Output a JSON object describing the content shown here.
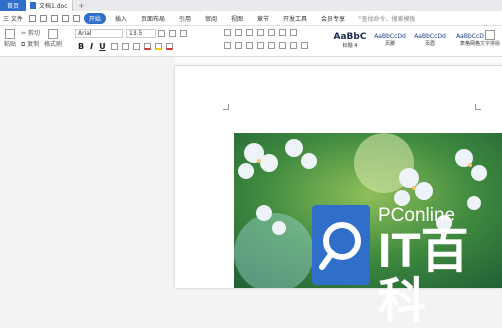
{
  "titlebar": {
    "home_tab": "首页",
    "doc_tab": "文档1.doc",
    "add_tab": "+"
  },
  "menubar": {
    "file_label": "三 文件",
    "tabs": [
      "开始",
      "插入",
      "页面布局",
      "引用",
      "审阅",
      "视图",
      "章节",
      "开发工具",
      "会员专享"
    ],
    "active_tab": "开始",
    "search_placeholder": "查找命令、搜索模板"
  },
  "ribbon": {
    "paste_label": "粘贴",
    "cut_label": "剪切",
    "copy_label": "复制",
    "format_painter_label": "格式刷",
    "font_name": "Arial",
    "font_size": "13.5",
    "bold": "B",
    "italic": "I",
    "underline": "U",
    "styles": [
      {
        "preview": "AaBbC",
        "name": "标题 4"
      },
      {
        "preview": "AaBbCcDd",
        "name": "页脚"
      },
      {
        "preview": "AaBbCcDd",
        "name": "页眉"
      },
      {
        "preview": "AaBbCcD",
        "name": "表格网格"
      }
    ],
    "text_tools_label": "文字排版"
  },
  "watermark": {
    "site": "PConline",
    "brand": "IT百科"
  }
}
